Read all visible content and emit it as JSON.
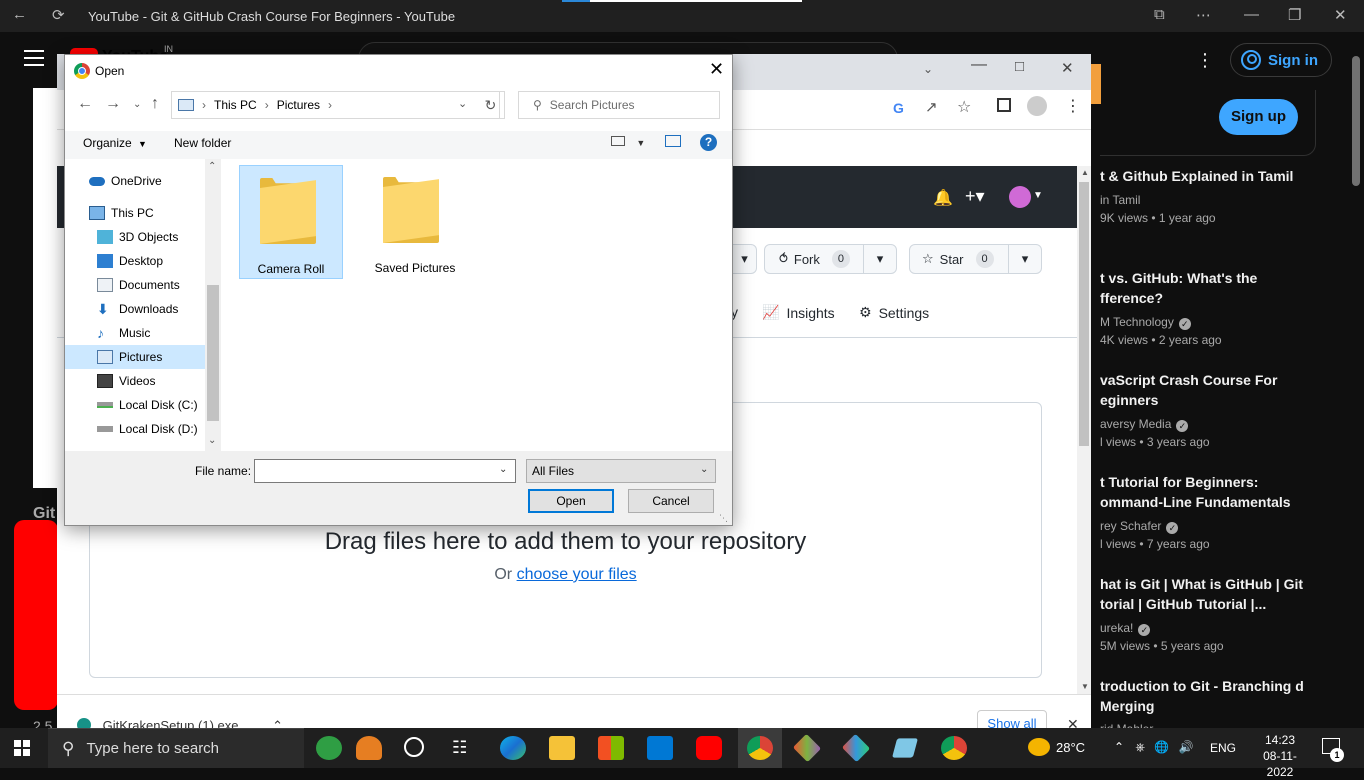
{
  "edge": {
    "title": "YouTube - Git & GitHub Crash Course For Beginners - YouTube"
  },
  "youtube": {
    "logo_text": "YouTube",
    "country": "IN",
    "sign_in": "Sign in",
    "sign_up": "Sign up",
    "left_title_fragment": "Git",
    "left_views_fragment": "2.5",
    "recommendations": [
      {
        "title": "t & Github Explained in Tamil",
        "channel": "in Tamil",
        "meta": "9K views • 1 year ago",
        "verified": false
      },
      {
        "title": "t vs. GitHub: What's the fference?",
        "channel": "M Technology",
        "meta": "4K views • 2 years ago",
        "verified": true
      },
      {
        "title": "vaScript Crash Course For eginners",
        "channel": "aversy Media",
        "meta": "l views • 3 years ago",
        "verified": true
      },
      {
        "title": "t Tutorial for Beginners: ommand-Line Fundamentals",
        "channel": "rey Schafer",
        "meta": "l views • 7 years ago",
        "verified": true
      },
      {
        "title": "hat is Git | What is GitHub | Git torial | GitHub Tutorial |...",
        "channel": "ureka!",
        "meta": "5M views • 5 years ago",
        "verified": true
      },
      {
        "title": "troduction to Git - Branching d Merging",
        "channel": "rid Mahler",
        "meta": "",
        "verified": false
      }
    ]
  },
  "github": {
    "fork_label": "Fork",
    "fork_count": "0",
    "star_label": "Star",
    "star_count": "0",
    "nav_partial": "y",
    "nav_insights": "Insights",
    "nav_settings": "Settings",
    "drop_title": "Drag files here to add them to your repository",
    "drop_or": "Or",
    "drop_link": "choose your files"
  },
  "downloads": {
    "file": "GitKrakenSetup (1).exe",
    "show_all": "Show all"
  },
  "dialog": {
    "title": "Open",
    "breadcrumb": [
      "This PC",
      "Pictures"
    ],
    "search_placeholder": "Search Pictures",
    "organize": "Organize",
    "new_folder": "New folder",
    "nav_items": [
      {
        "label": "OneDrive",
        "icon": "cloud-icon"
      },
      {
        "label": "This PC",
        "icon": "computer-icon"
      },
      {
        "label": "3D Objects",
        "icon": "cube-icon"
      },
      {
        "label": "Desktop",
        "icon": "desktop-icon"
      },
      {
        "label": "Documents",
        "icon": "document-icon"
      },
      {
        "label": "Downloads",
        "icon": "download-icon"
      },
      {
        "label": "Music",
        "icon": "music-icon"
      },
      {
        "label": "Pictures",
        "icon": "pictures-icon"
      },
      {
        "label": "Videos",
        "icon": "video-icon"
      },
      {
        "label": "Local Disk (C:)",
        "icon": "disk-icon"
      },
      {
        "label": "Local Disk (D:)",
        "icon": "disk-icon"
      }
    ],
    "selected_nav": "Pictures",
    "files": [
      {
        "label": "Camera Roll",
        "selected": true
      },
      {
        "label": "Saved Pictures",
        "selected": false
      }
    ],
    "file_name_label": "File name:",
    "file_name_value": "",
    "file_type": "All Files",
    "open_button": "Open",
    "cancel_button": "Cancel"
  },
  "taskbar": {
    "search_placeholder": "Type here to search",
    "weather": "28°C",
    "language": "ENG",
    "time": "14:23",
    "date": "08-11-2022",
    "notifications": "1"
  }
}
